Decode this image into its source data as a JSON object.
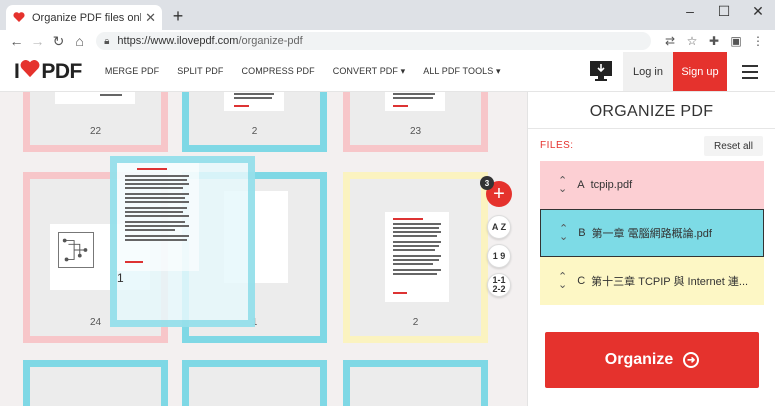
{
  "browser": {
    "tab_title": "Organize PDF files online. Free",
    "new_tab": "+",
    "url_protocol": "https://",
    "url_domain": "www.ilovepdf.com",
    "url_path": "/organize-pdf"
  },
  "header": {
    "logo_left": "I",
    "logo_right": "PDF",
    "nav": [
      "MERGE PDF",
      "SPLIT PDF",
      "COMPRESS PDF",
      "CONVERT PDF ▾",
      "ALL PDF TOOLS ▾"
    ],
    "login": "Log in",
    "signup": "Sign up"
  },
  "workspace": {
    "pages": {
      "p22": "22",
      "p2a": "2",
      "p23": "23",
      "p24": "24",
      "p1a": "1",
      "p1b": "1",
      "p2b": "2"
    },
    "badge": "3",
    "add_symbol": "+",
    "sort_az": "A Z",
    "sort_19": "1 9",
    "range": "1-1 2-2"
  },
  "sidebar": {
    "title": "ORGANIZE PDF",
    "files_label": "FILES:",
    "reset": "Reset all",
    "files": [
      {
        "letter": "A",
        "name": "tcpip.pdf"
      },
      {
        "letter": "B",
        "name": "第一章 電腦網路概論.pdf"
      },
      {
        "letter": "C",
        "name": "第十三章 TCPIP 與 Internet 連..."
      }
    ],
    "organize": "Organize"
  },
  "colors": {
    "brand_red": "#e5322d",
    "file_a": "#fccfd3",
    "file_b": "#7ddbe6",
    "file_c": "#fdf7c5"
  }
}
